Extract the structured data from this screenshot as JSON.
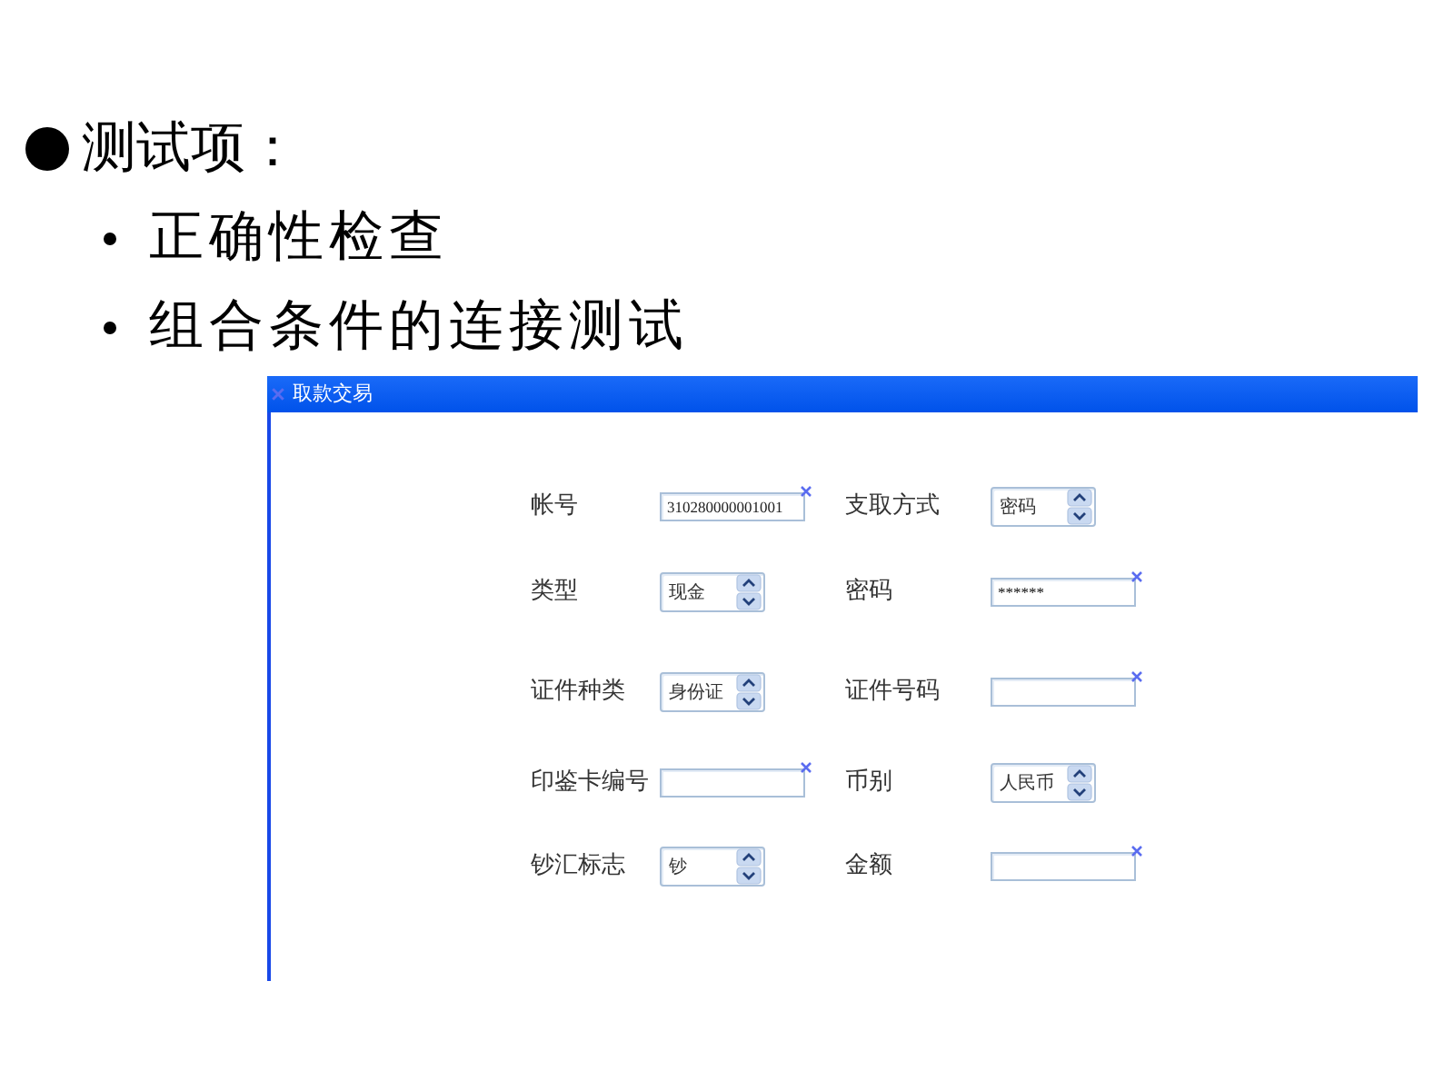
{
  "slide": {
    "title": "测试项：",
    "bullets": [
      {
        "text": "正确性检查"
      },
      {
        "text": "组合条件的连接测试"
      }
    ]
  },
  "window": {
    "title": "取款交易",
    "fields": [
      {
        "label": "帐号",
        "kind": "text",
        "value": "310280000001001"
      },
      {
        "label": "支取方式",
        "kind": "spinner",
        "value": "密码"
      },
      {
        "label": "类型",
        "kind": "spinner",
        "value": "现金"
      },
      {
        "label": "密码",
        "kind": "text",
        "value": "******"
      },
      {
        "label": "证件种类",
        "kind": "spinner",
        "value": "身份证"
      },
      {
        "label": "证件号码",
        "kind": "text"
      },
      {
        "label": "印鉴卡编号",
        "kind": "text"
      },
      {
        "label": "币别",
        "kind": "spinner",
        "value": "人民币"
      },
      {
        "label": "钞汇标志",
        "kind": "spinner",
        "value": "钞"
      },
      {
        "label": "金额",
        "kind": "text"
      }
    ]
  }
}
